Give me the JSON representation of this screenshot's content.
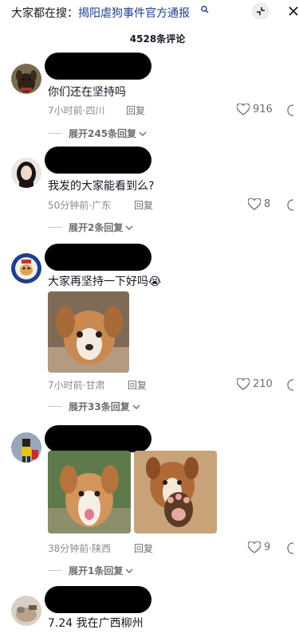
{
  "search": {
    "prefix": "大家都在搜：",
    "topic": "揭阳虐狗事件官方通报"
  },
  "comment_count": "4528条评论",
  "comments": [
    {
      "text": "你们还在坚持吗",
      "meta": "7小时前·四川",
      "reply_label": "回复",
      "likes": "916",
      "expand": "展开245条回复"
    },
    {
      "text": "我发的大家能看到么?",
      "meta": "50分钟前·广东",
      "reply_label": "回复",
      "likes": "8",
      "expand": "展开2条回复"
    },
    {
      "text": "大家再坚持一下好吗😭",
      "meta": "7小时前·甘肃",
      "reply_label": "回复",
      "likes": "210",
      "expand": "展开33条回复"
    },
    {
      "text": "",
      "meta": "38分钟前·陕西",
      "reply_label": "回复",
      "likes": "9",
      "expand": "展开1条回复"
    },
    {
      "text": "7.24 我在广西柳州",
      "meta": "",
      "reply_label": "",
      "likes": "",
      "expand": ""
    }
  ],
  "colors": {
    "topic_blue": "#1f3f8c",
    "meta_gray": "#8a8b91",
    "text_dark": "#161823"
  },
  "icons": [
    "search-icon",
    "shrink-icon",
    "close-icon",
    "heart-icon",
    "chevron-down-icon",
    "share-icon"
  ]
}
